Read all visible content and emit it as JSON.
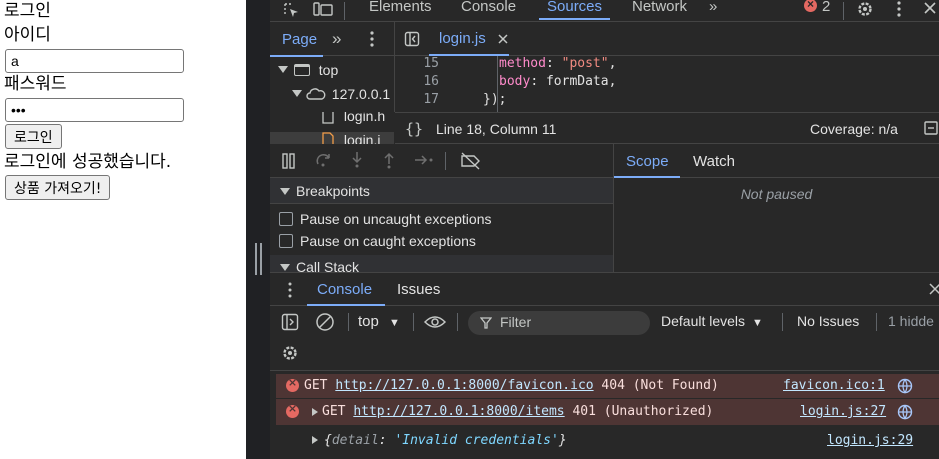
{
  "page": {
    "title": "로그인",
    "id_label": "아이디",
    "id_value": "a",
    "pw_label": "패스워드",
    "pw_value": "•••",
    "login_button": "로그인",
    "success_message": "로그인에 성공했습니다.",
    "fetch_button": "상품 가져오기!"
  },
  "devtools": {
    "tabs": [
      "Elements",
      "Console",
      "Sources",
      "Network"
    ],
    "active_tab": "Sources",
    "more_tabs": "»",
    "error_count": "2",
    "nav": {
      "page_tab": "Page",
      "more": "»"
    },
    "file_tab": "login.js",
    "tree": {
      "top": "top",
      "host": "127.0.0.1",
      "file1": "login.h",
      "file2": "login.j"
    },
    "code": [
      {
        "ln": "15",
        "key": "method",
        "val": "\"post\""
      },
      {
        "ln": "16",
        "key": "body",
        "val": "formData"
      },
      {
        "ln": "17",
        "text": "});"
      }
    ],
    "status": {
      "position": "Line 18, Column 11",
      "coverage": "Coverage: n/a"
    },
    "scope_tabs": [
      "Scope",
      "Watch"
    ],
    "not_paused": "Not paused",
    "breakpoints": {
      "title": "Breakpoints",
      "uncaught": "Pause on uncaught exceptions",
      "caught": "Pause on caught exceptions",
      "call_stack": "Call Stack"
    },
    "drawer": {
      "console_tab": "Console",
      "issues_tab": "Issues"
    },
    "console_toolbar": {
      "context": "top",
      "filter_placeholder": "Filter",
      "levels": "Default levels",
      "no_issues": "No Issues",
      "hidden": "1 hidde"
    },
    "messages": [
      {
        "prefix": "GET ",
        "url": "http://127.0.0.1:8000/favicon.ico",
        "status": " 404 (Not Found)",
        "source": "favicon.ico:1"
      },
      {
        "prefix": "GET ",
        "url": "http://127.0.0.1:8000/items",
        "status": " 401 (Unauthorized)",
        "source": "login.js:27"
      },
      {
        "obj_key": "detail",
        "obj_val": "'Invalid credentials'",
        "source": "login.js:29"
      }
    ]
  }
}
